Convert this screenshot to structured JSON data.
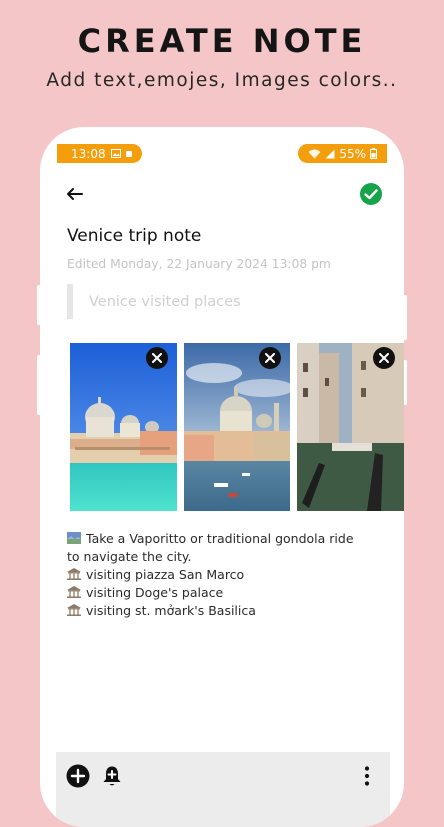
{
  "promo": {
    "title": "CREATE NOTE",
    "subtitle": "Add text,emojes, Images colors.."
  },
  "status_bar": {
    "time": "13:08",
    "battery": "55%",
    "accent_color": "#f59e0b"
  },
  "header": {
    "back_icon": "arrow-left-icon",
    "save_icon": "check-circle-icon",
    "save_color": "#16a34a"
  },
  "note": {
    "title": "Venice trip note",
    "edited": "Edited Monday, 22 January 2024 13:08 pm",
    "subtitle_placeholder": "Venice visited places",
    "images": [
      {
        "description": "Venice basilica over turquoise water",
        "remove_icon": "close-icon"
      },
      {
        "description": "Grand Canal with Santa Maria della Salute",
        "remove_icon": "close-icon"
      },
      {
        "description": "Venice canal with gondolas",
        "remove_icon": "close-icon"
      }
    ],
    "lines": [
      {
        "icon": "landscape-icon",
        "text": "Take a Vaporitto or traditional gondola ride"
      },
      {
        "icon": "",
        "text": "to navigate the city."
      },
      {
        "icon": "classical-building-icon",
        "text": "visiting piazza San Marco"
      },
      {
        "icon": "classical-building-icon",
        "text": "visiting Doge's palace"
      },
      {
        "icon": "classical-building-icon",
        "text": "visiting st. mởark's Basilica"
      }
    ]
  },
  "toolbar": {
    "items": [
      "add-circle-icon",
      "add-reminder-bell-icon",
      "more-vertical-icon"
    ]
  }
}
